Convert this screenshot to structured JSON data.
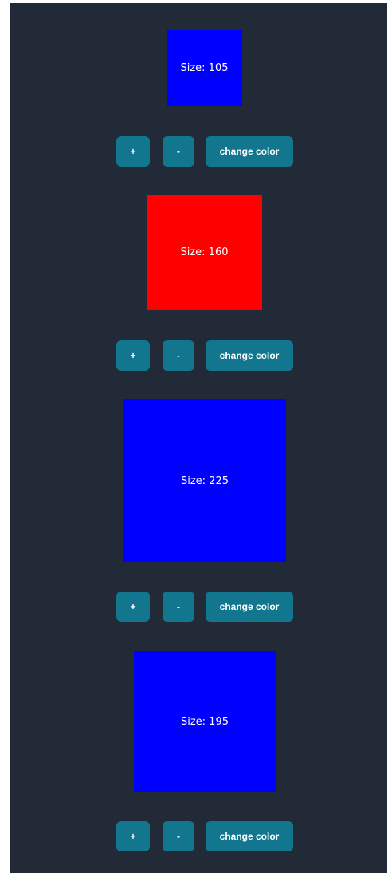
{
  "buttons": {
    "plus_label": "+",
    "minus_label": "-",
    "color_label": "change color"
  },
  "boxes": [
    {
      "label": "Size: 105",
      "size": 105,
      "color": "#0000ff"
    },
    {
      "label": "Size: 160",
      "size": 160,
      "color": "#ff0000"
    },
    {
      "label": "Size: 225",
      "size": 225,
      "color": "#0000ff"
    },
    {
      "label": "Size: 195",
      "size": 195,
      "color": "#0000ff"
    }
  ]
}
